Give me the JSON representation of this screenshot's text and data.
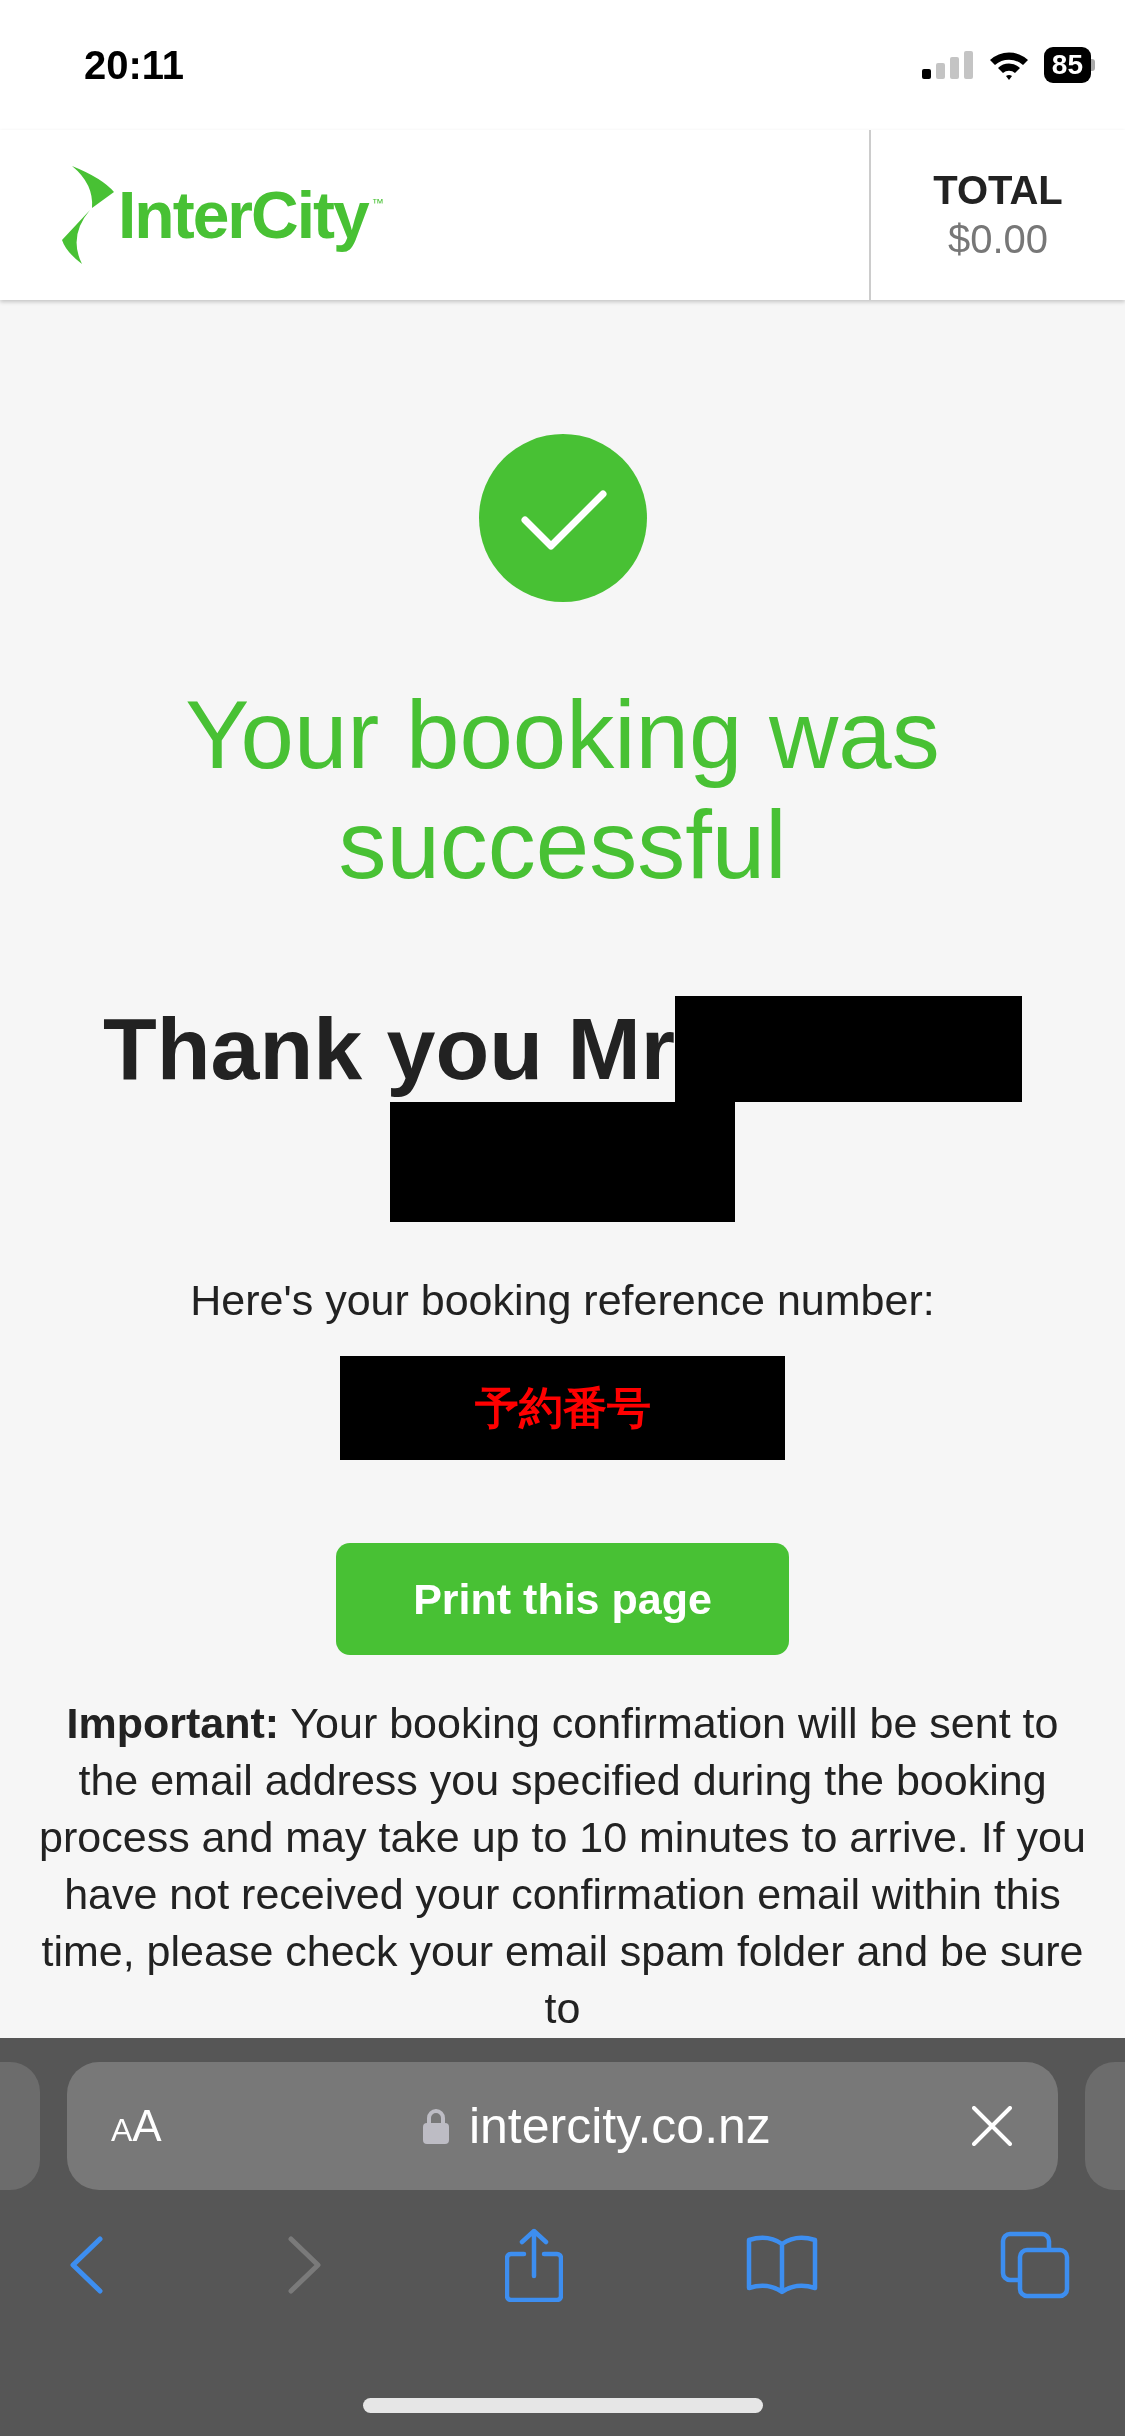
{
  "status_bar": {
    "time": "20:11",
    "battery": "85"
  },
  "header": {
    "logo": "InterCity",
    "trademark": "™",
    "total_label": "TOTAL",
    "total_value": "$0.00"
  },
  "confirmation": {
    "title": "Your booking was successful",
    "greeting": "Thank you Mr",
    "reference_label": "Here's your booking reference number:",
    "reference": "予約番号",
    "print_button": "Print this page",
    "notice": "**Important:** Your booking confirmation will be sent to the email address you specified during the booking process and may take up to 10 minutes to arrive. If you have not received your confirmation email within this time, please check your email spam folder and be sure to"
  },
  "browser": {
    "reader_button": "AA",
    "url": "intercity.co.nz",
    "toolbar": [
      {
        "kind": "back",
        "disabled": false
      },
      {
        "kind": "forward",
        "disabled": true
      },
      {
        "kind": "share",
        "disabled": false
      },
      {
        "kind": "bookmarks",
        "disabled": false
      },
      {
        "kind": "tabs",
        "disabled": false
      }
    ]
  }
}
